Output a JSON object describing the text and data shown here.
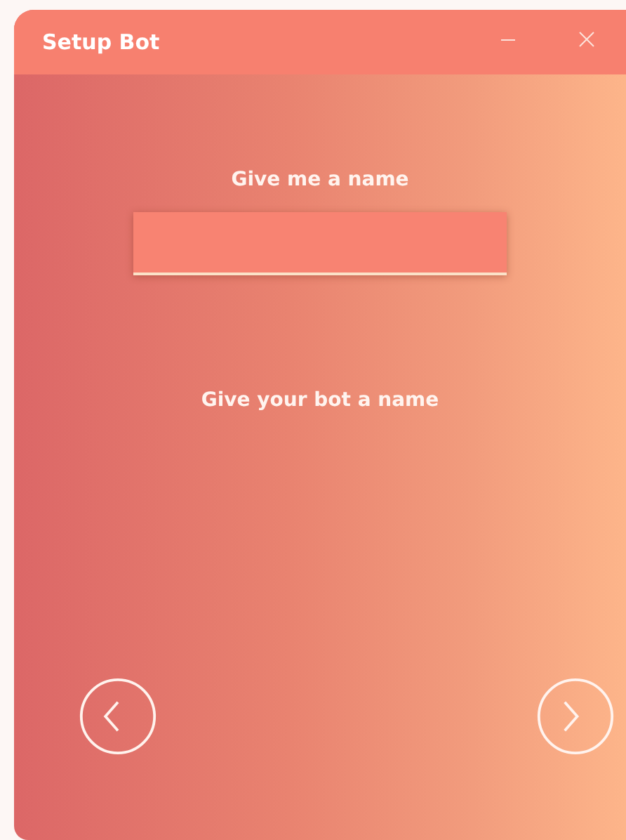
{
  "window": {
    "title": "Setup Bot"
  },
  "prompt": "Give me a name",
  "hint": "Give your bot a name",
  "nav_buttons": [
    {
      "kind": "back"
    },
    {
      "kind": "next"
    }
  ]
}
